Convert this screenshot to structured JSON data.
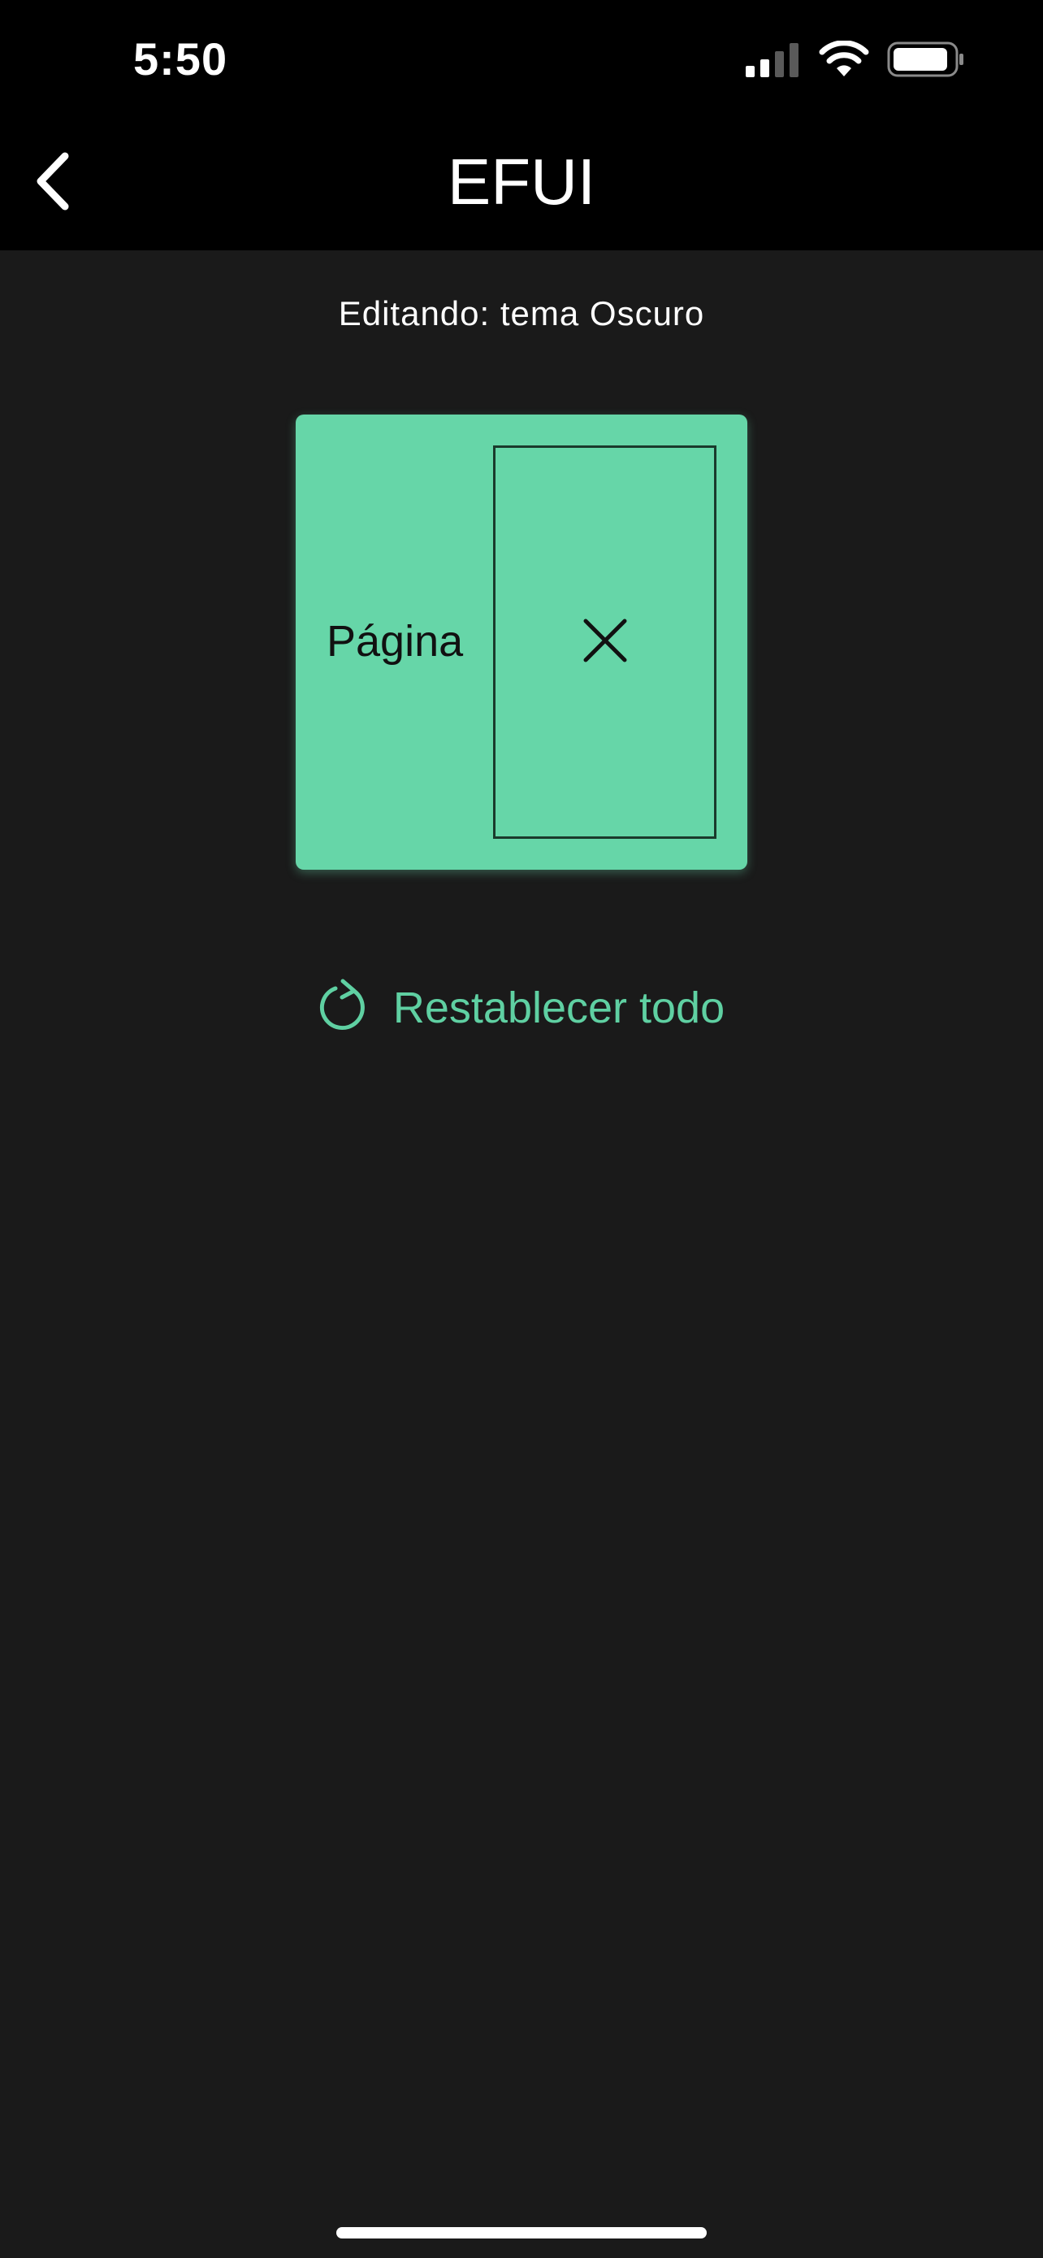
{
  "status_bar": {
    "time": "5:50",
    "signal_icon": "cellular-signal-icon",
    "wifi_icon": "wifi-icon",
    "battery_icon": "battery-icon"
  },
  "header": {
    "title": "EFUI",
    "back_icon": "chevron-left-icon"
  },
  "editor": {
    "editing_label": "Editando: tema Oscuro"
  },
  "preview": {
    "page_label": "Página",
    "close_icon": "close-icon",
    "accent_color": "#66d6a8"
  },
  "actions": {
    "reset_label": "Restablecer todo",
    "reset_icon": "refresh-icon",
    "accent_color": "#5fd0a2"
  },
  "theme": {
    "background": "#1a1a1a",
    "header_background": "#000000"
  }
}
